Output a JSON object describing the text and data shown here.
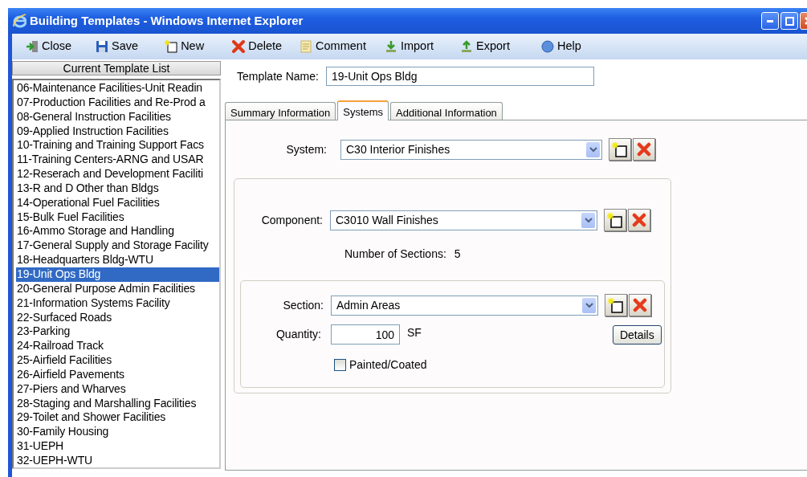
{
  "window": {
    "title": "Building Templates - Windows Internet Explorer"
  },
  "toolbar": [
    {
      "label": "Close"
    },
    {
      "label": "Save"
    },
    {
      "label": "New"
    },
    {
      "label": "Delete"
    },
    {
      "label": "Comment"
    },
    {
      "label": "Import"
    },
    {
      "label": "Export"
    },
    {
      "label": "Help"
    }
  ],
  "template_list": {
    "header": "Current Template List",
    "items": [
      {
        "label": "06-Maintenance Facilities-Unit Readin",
        "selected": false
      },
      {
        "label": "07-Production Facilities and Re-Prod a",
        "selected": false
      },
      {
        "label": "08-General Instruction Facilities",
        "selected": false
      },
      {
        "label": "09-Applied Instruction Facilities",
        "selected": false
      },
      {
        "label": "10-Training and Training Support Facs",
        "selected": false
      },
      {
        "label": "11-Training Centers-ARNG and USAR",
        "selected": false
      },
      {
        "label": "12-Reserach and Development Faciliti",
        "selected": false
      },
      {
        "label": "13-R and D Other than Bldgs",
        "selected": false
      },
      {
        "label": "14-Operational Fuel Facilities",
        "selected": false
      },
      {
        "label": "15-Bulk Fuel Facilities",
        "selected": false
      },
      {
        "label": "16-Ammo Storage and Handling",
        "selected": false
      },
      {
        "label": "17-General Supply and Storage Facility",
        "selected": false
      },
      {
        "label": "18-Headquarters Bldg-WTU",
        "selected": false
      },
      {
        "label": "19-Unit Ops Bldg",
        "selected": true
      },
      {
        "label": "20-General Purpose Admin Facilities",
        "selected": false
      },
      {
        "label": "21-Information Systems Facility",
        "selected": false
      },
      {
        "label": "22-Surfaced Roads",
        "selected": false
      },
      {
        "label": "23-Parking",
        "selected": false
      },
      {
        "label": "24-Railroad Track",
        "selected": false
      },
      {
        "label": "25-Airfield Facilities",
        "selected": false
      },
      {
        "label": "26-Airfield Pavements",
        "selected": false
      },
      {
        "label": "27-Piers and Wharves",
        "selected": false
      },
      {
        "label": "28-Staging and Marshalling Facilities",
        "selected": false
      },
      {
        "label": "29-Toilet and Shower Facilities",
        "selected": false
      },
      {
        "label": "30-Family Housing",
        "selected": false
      },
      {
        "label": "31-UEPH",
        "selected": false
      },
      {
        "label": "32-UEPH-WTU",
        "selected": false
      }
    ]
  },
  "template_name": {
    "label": "Template Name:",
    "value": "19-Unit Ops Bldg"
  },
  "tabs": [
    {
      "label": "Summary Information",
      "selected": false
    },
    {
      "label": "Systems",
      "selected": true
    },
    {
      "label": "Additional Information",
      "selected": false
    }
  ],
  "system": {
    "label": "System:",
    "value": "C30 Interior Finishes"
  },
  "component": {
    "label": "Component:",
    "value": "C3010 Wall Finishes"
  },
  "number_of_sections": {
    "label": "Number of Sections:",
    "value": "5"
  },
  "section": {
    "label": "Section:",
    "value": "Admin Areas"
  },
  "quantity": {
    "label": "Quantity:",
    "value": "100",
    "unit": "SF"
  },
  "painted_coated": {
    "label": "Painted/Coated",
    "checked": false
  },
  "details_button": {
    "label": "Details"
  }
}
